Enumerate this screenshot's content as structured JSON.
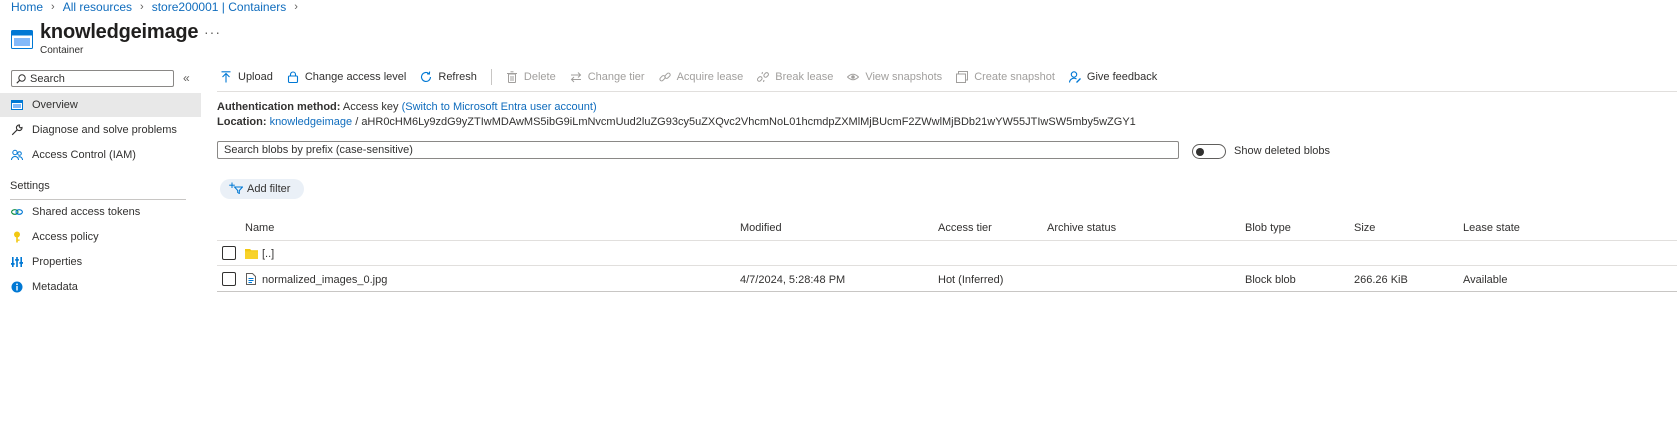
{
  "breadcrumb": [
    "Home",
    "All resources",
    "store200001 | Containers"
  ],
  "header": {
    "title": "knowledgeimage",
    "subtitle": "Container",
    "more": "···"
  },
  "sidebar": {
    "search_placeholder": "Search",
    "collapse": "«",
    "items": [
      {
        "label": "Overview",
        "icon": "container-icon",
        "active": true
      },
      {
        "label": "Diagnose and solve problems",
        "icon": "wrench-icon"
      },
      {
        "label": "Access Control (IAM)",
        "icon": "people-icon"
      }
    ],
    "section_settings": "Settings",
    "settings_items": [
      {
        "label": "Shared access tokens",
        "icon": "link-icon"
      },
      {
        "label": "Access policy",
        "icon": "key-icon"
      },
      {
        "label": "Properties",
        "icon": "sliders-icon"
      },
      {
        "label": "Metadata",
        "icon": "info-icon"
      }
    ]
  },
  "toolbar": {
    "upload": "Upload",
    "change_access": "Change access level",
    "refresh": "Refresh",
    "delete": "Delete",
    "change_tier": "Change tier",
    "acquire_lease": "Acquire lease",
    "break_lease": "Break lease",
    "view_snapshots": "View snapshots",
    "create_snapshot": "Create snapshot",
    "feedback": "Give feedback"
  },
  "info": {
    "auth_label": "Authentication method:",
    "auth_value": "Access key",
    "auth_link": "(Switch to Microsoft Entra user account)",
    "location_label": "Location:",
    "location_link": "knowledgeimage",
    "location_sep": "/",
    "location_path": "aHR0cHM6Ly9zdG9yZTIwMDAwMS5ibG9iLmNvcmUud2luZG93cy5uZXQvc2VhcmNoL01hcmdpZXMlMjBUcmF2ZWwlMjBDb21wYW55JTIwSW5mby5wZGY1"
  },
  "blob_search": {
    "placeholder": "Search blobs by prefix (case-sensitive)"
  },
  "show_deleted": {
    "label": "Show deleted blobs",
    "on": false
  },
  "filter": {
    "label": "Add filter"
  },
  "table": {
    "columns": [
      "Name",
      "Modified",
      "Access tier",
      "Archive status",
      "Blob type",
      "Size",
      "Lease state"
    ],
    "rows": [
      {
        "name": "[..]",
        "type": "folder",
        "modified": "",
        "tier": "",
        "archive": "",
        "blob_type": "",
        "size": "",
        "lease": ""
      },
      {
        "name": "normalized_images_0.jpg",
        "type": "file",
        "modified": "4/7/2024, 5:28:48 PM",
        "tier": "Hot (Inferred)",
        "archive": "",
        "blob_type": "Block blob",
        "size": "266.26 KiB",
        "lease": "Available"
      }
    ]
  },
  "colors": {
    "accent": "#0f6cbd",
    "folder": "#f2c811"
  }
}
